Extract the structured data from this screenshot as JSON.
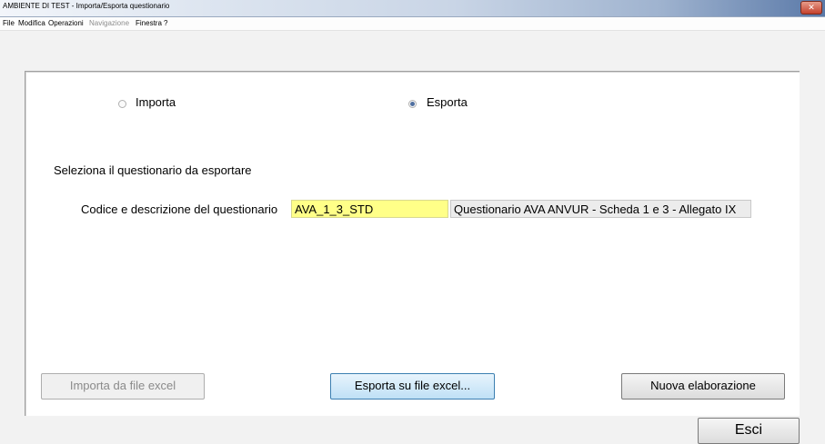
{
  "window": {
    "title": "AMBIENTE DI TEST - Importa/Esporta questionario",
    "close_glyph": "✕"
  },
  "menu": {
    "items": [
      "File",
      "Modifica",
      "Operazioni",
      "Navigazione",
      "Finestra",
      "?"
    ],
    "disabled": [
      "Navigazione"
    ]
  },
  "mode": {
    "importa_label": "Importa",
    "esporta_label": "Esporta",
    "selected": "Esporta"
  },
  "selection": {
    "heading": "Seleziona il questionario da esportare",
    "field_label": "Codice e descrizione del questionario",
    "code_value": "AVA_1_3_STD",
    "description_value": "Questionario AVA ANVUR - Scheda 1 e 3 - Allegato IX"
  },
  "buttons": {
    "importa": "Importa da file excel",
    "esporta": "Esporta su file excel...",
    "nuova": "Nuova elaborazione",
    "esci": "Esci"
  },
  "colors": {
    "code_field_bg": "#ffff88",
    "description_field_bg": "#ececec",
    "accent_border": "#3c7fb1"
  }
}
